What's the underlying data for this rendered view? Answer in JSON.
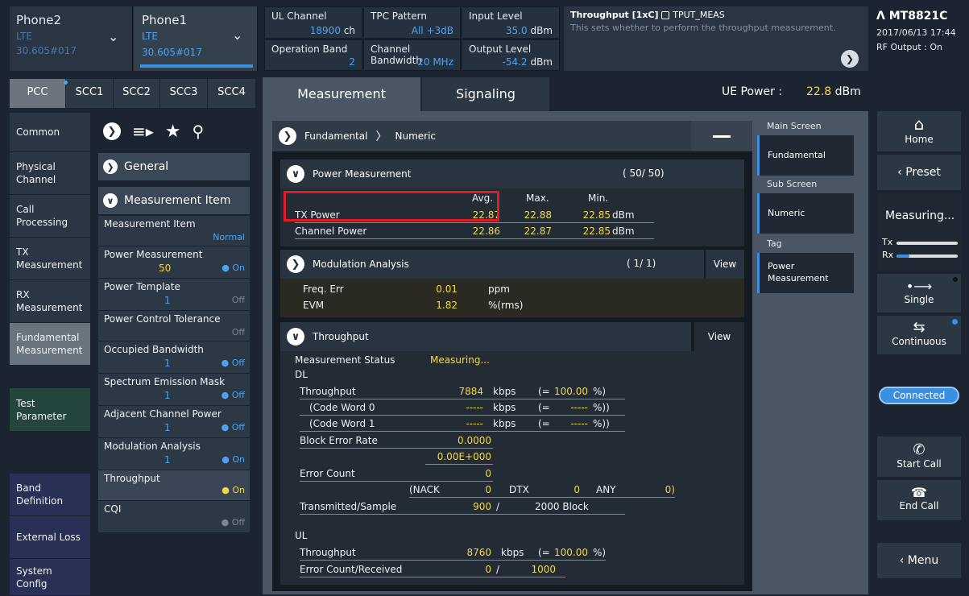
{
  "phones": [
    {
      "name": "Phone2",
      "tech": "LTE",
      "version": "30.605#017"
    },
    {
      "name": "Phone1",
      "tech": "LTE",
      "version": "30.605#017"
    }
  ],
  "params": {
    "ul_channel": {
      "label": "UL Channel",
      "value": "18900",
      "unit": "ch"
    },
    "tpc_pattern": {
      "label": "TPC Pattern",
      "value": "All +3dB"
    },
    "input_level": {
      "label": "Input Level",
      "value": "35.0",
      "unit": "dBm"
    },
    "operation_band": {
      "label": "Operation Band",
      "value": "2"
    },
    "channel_bandwidth": {
      "label": "Channel Bandwidth",
      "value": "20 MHz"
    },
    "output_level": {
      "label": "Output Level",
      "value": "-54.2",
      "unit": "dBm"
    }
  },
  "info": {
    "title": "Throughput [1xC]",
    "tag": "TPUT_MEAS",
    "desc": "This sets whether to perform the throughput measurement."
  },
  "device": {
    "model": "MT8821C",
    "date": "2017/06/13 17:44",
    "rf": "RF Output : On"
  },
  "scc_tabs": [
    "PCC",
    "SCC1",
    "SCC2",
    "SCC3",
    "SCC4"
  ],
  "main_tabs": {
    "measurement": "Measurement",
    "signaling": "Signaling"
  },
  "ue_power": {
    "label": "UE Power :",
    "value": "22.8",
    "unit": "dBm"
  },
  "sidebar": [
    "Common",
    "Physical Channel",
    "Call Processing",
    "TX Measurement",
    "RX Measurement",
    "Fundamental Measurement",
    "Test Parameter",
    "Band Definition",
    "External Loss",
    "System Config"
  ],
  "menu": {
    "general": "General",
    "measurement_item": "Measurement Item",
    "items": [
      {
        "label": "Measurement Item",
        "value": "Normal",
        "toggle": ""
      },
      {
        "label": "Power Measurement",
        "value": "50",
        "toggle": "On"
      },
      {
        "label": "Power Template",
        "value": "1",
        "toggle": "Off"
      },
      {
        "label": "Power Control Tolerance",
        "value": "",
        "toggle": "Off"
      },
      {
        "label": "Occupied Bandwidth",
        "value": "1",
        "toggle": "Off"
      },
      {
        "label": "Spectrum Emission Mask",
        "value": "1",
        "toggle": "Off"
      },
      {
        "label": "Adjacent Channel Power",
        "value": "1",
        "toggle": "Off"
      },
      {
        "label": "Modulation Analysis",
        "value": "1",
        "toggle": "On"
      },
      {
        "label": "Throughput",
        "value": "",
        "toggle": "On"
      },
      {
        "label": "CQI",
        "value": "",
        "toggle": "Off"
      }
    ]
  },
  "breadcrumb": {
    "a": "Fundamental",
    "b": "Numeric"
  },
  "power": {
    "title": "Power Measurement",
    "count": "( 50/ 50)",
    "hdr": {
      "avg": "Avg.",
      "max": "Max.",
      "min": "Min."
    },
    "tx": {
      "label": "TX Power",
      "avg": "22.87",
      "max": "22.88",
      "min": "22.85",
      "unit": "dBm"
    },
    "ch": {
      "label": "Channel Power",
      "avg": "22.86",
      "max": "22.87",
      "min": "22.85",
      "unit": "dBm"
    }
  },
  "mod": {
    "title": "Modulation Analysis",
    "count": "( 1/ 1)",
    "view": "View",
    "freq": {
      "label": "Freq. Err",
      "value": "0.01",
      "unit": "ppm"
    },
    "evm": {
      "label": "EVM",
      "value": "1.82",
      "unit": "%(rms)"
    }
  },
  "tput": {
    "title": "Throughput",
    "view": "View",
    "status_label": "Measurement Status",
    "status_value": "Measuring...",
    "dl": "DL",
    "throughput": {
      "label": "Throughput",
      "value": "7884",
      "unit": "kbps",
      "pct_open": "(=",
      "pct": "100.00",
      "pct_close": "%)"
    },
    "cw0": {
      "label": "(Code Word 0",
      "value": "-----",
      "unit": "kbps",
      "pct_open": "(=",
      "pct": "-----",
      "pct_close": "%))"
    },
    "cw1": {
      "label": "(Code Word 1",
      "value": "-----",
      "unit": "kbps",
      "pct_open": "(=",
      "pct": "-----",
      "pct_close": "%))"
    },
    "bler": {
      "label": "Block Error Rate",
      "value": "0.0000",
      "value2": "0.00E+000"
    },
    "err": {
      "label": "Error Count",
      "value": "0"
    },
    "nack": {
      "nack_label": "(NACK",
      "nack": "0",
      "dtx_label": "DTX",
      "dtx": "0",
      "any_label": "ANY",
      "any": "0)"
    },
    "trans": {
      "label": "Transmitted/Sample",
      "value": "900",
      "sep": "/",
      "total": "2000 Block"
    },
    "ul": "UL",
    "ul_tput": {
      "label": "Throughput",
      "value": "8760",
      "unit": "kbps",
      "pct_open": "(=",
      "pct": "100.00",
      "pct_close": "%)"
    },
    "ul_err": {
      "label": "Error Count/Received",
      "value": "0",
      "sep": "/",
      "total": "1000"
    }
  },
  "screens": {
    "main": "Main Screen",
    "fundamental": "Fundamental",
    "sub": "Sub Screen",
    "numeric": "Numeric",
    "tag": "Tag",
    "powermeas": "Power Measurement"
  },
  "right": {
    "home": "Home",
    "preset": "Preset",
    "measuring": "Measuring...",
    "tx": "Tx",
    "rx": "Rx",
    "single": "Single",
    "continuous": "Continuous",
    "connected": "Connected",
    "start_call": "Start Call",
    "end_call": "End Call",
    "menu": "Menu"
  }
}
